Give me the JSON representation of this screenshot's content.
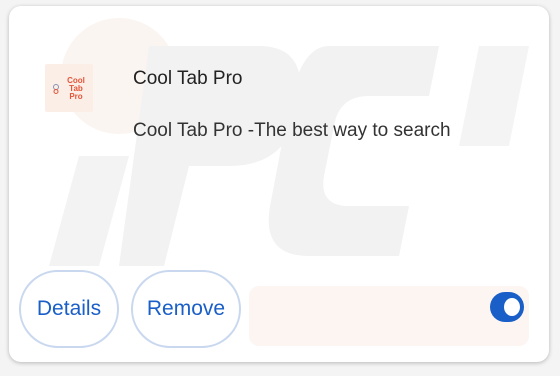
{
  "extension": {
    "icon_name": "cool-tab-pro-logo",
    "icon_text": [
      "Cool",
      "Tab",
      "Pro"
    ],
    "name": "Cool Tab Pro",
    "description": "Cool Tab Pro -The best way to search"
  },
  "actions": {
    "details_label": "Details",
    "remove_label": "Remove"
  },
  "toggle": {
    "enabled": true
  },
  "colors": {
    "accent": "#1a5fc8",
    "logo_text": "#e4553a",
    "button_border": "#c9d8ef"
  }
}
